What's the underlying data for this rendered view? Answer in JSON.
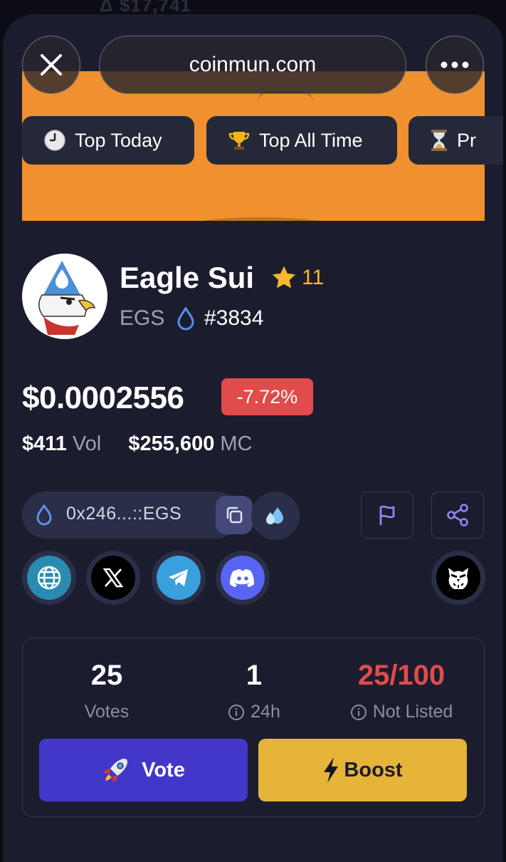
{
  "browser": {
    "url": "coinmun.com",
    "close_icon": "close-icon",
    "more_icon": "more-dots-icon"
  },
  "tabs": [
    {
      "label": "Top Today",
      "icon": "clock-icon"
    },
    {
      "label": "Top All Time",
      "icon": "trophy-icon"
    },
    {
      "label": "Pr",
      "icon": "hourglass-icon"
    }
  ],
  "token": {
    "name": "Eagle Sui",
    "favorites": "11",
    "ticker": "EGS",
    "rank": "#3834",
    "price": "$0.0002556",
    "change": "-7.72%",
    "volume_value": "$411",
    "volume_label": "Vol",
    "mc_value": "$255,600",
    "mc_label": "MC",
    "contract": "0x246...::EGS"
  },
  "stats": {
    "votes_value": "25",
    "votes_label": "Votes",
    "day_value": "1",
    "day_label": "24h",
    "listing_value": "25/100",
    "listing_label": "Not Listed"
  },
  "actions": {
    "vote_label": "Vote",
    "boost_label": "Boost"
  },
  "colors": {
    "background": "#1b1d2e",
    "accent_vote": "#4337c9",
    "accent_boost": "#e7b43a",
    "negative": "#e14b4b",
    "star": "#f5b82e"
  }
}
